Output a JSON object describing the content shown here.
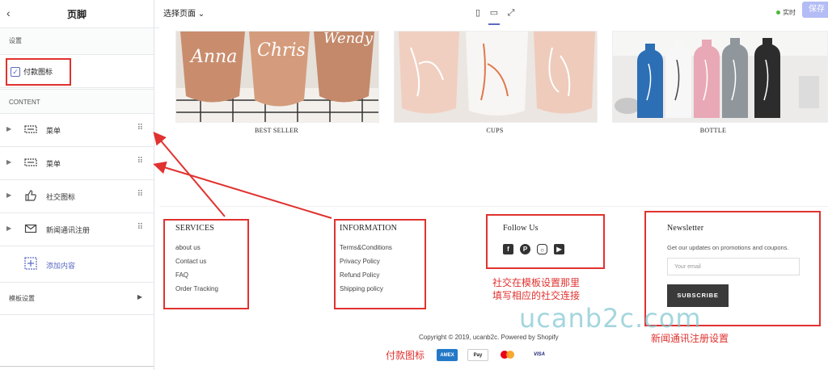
{
  "sidebar": {
    "title": "页脚",
    "settings_label": "设置",
    "payment_icons_label": "付款图标",
    "content_label": "CONTENT",
    "items": [
      {
        "label": "菜单"
      },
      {
        "label": "菜单"
      },
      {
        "label": "社交图标"
      },
      {
        "label": "新闻通讯注册"
      },
      {
        "label": "添加内容"
      }
    ],
    "template_settings": "模板设置"
  },
  "topbar": {
    "select_page": "选择页面",
    "live": "实时",
    "save": "保存"
  },
  "products": [
    {
      "caption": "BEST SELLER"
    },
    {
      "caption": "CUPS"
    },
    {
      "caption": "BOTTLE"
    }
  ],
  "footer": {
    "services": {
      "title": "SERVICES",
      "links": [
        "about us",
        "Contact us",
        "FAQ",
        "Order Tracking"
      ]
    },
    "information": {
      "title": "INFORMATION",
      "links": [
        "Terms&Conditions",
        "Privacy Policy",
        "Refund Policy",
        "Shipping policy"
      ]
    },
    "follow": {
      "title": "Follow Us"
    },
    "newsletter": {
      "title": "Newsletter",
      "desc": "Get our updates on promotions and coupons.",
      "placeholder": "Your email",
      "button": "SUBSCRIBE"
    },
    "copyright": "Copyright © 2019, ucanb2c. Powered by Shopify",
    "payments": [
      "AMEX",
      "Pay",
      "",
      "VISA"
    ]
  },
  "annotations": {
    "social": "社交在模板设置那里\n填写相应的社交连接",
    "newsletter": "新闻通讯注册设置",
    "payment": "付款图标"
  },
  "watermark": "ucanb2c.com"
}
